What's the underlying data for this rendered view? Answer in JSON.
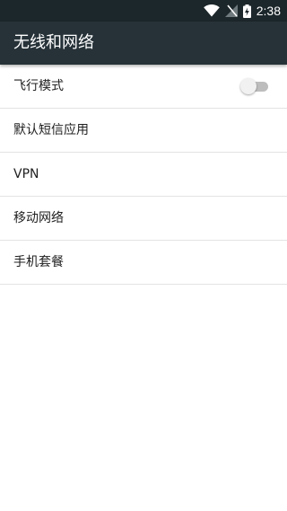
{
  "status_bar": {
    "time": "2:38",
    "icons": [
      "wifi-icon",
      "no-sim-icon",
      "battery-charging-icon"
    ]
  },
  "app_bar": {
    "title": "无线和网络"
  },
  "settings": {
    "items": [
      {
        "label": "飞行模式",
        "control": "toggle",
        "state": "off"
      },
      {
        "label": "默认短信应用"
      },
      {
        "label": "VPN"
      },
      {
        "label": "移动网络"
      },
      {
        "label": "手机套餐"
      }
    ]
  },
  "colors": {
    "status_bar": "#1c272b",
    "app_bar": "#263238",
    "background": "#ffffff",
    "divider": "#e3e3e3",
    "toggle_off_track": "#bdbdbd",
    "toggle_off_thumb": "#f1f1f1"
  }
}
